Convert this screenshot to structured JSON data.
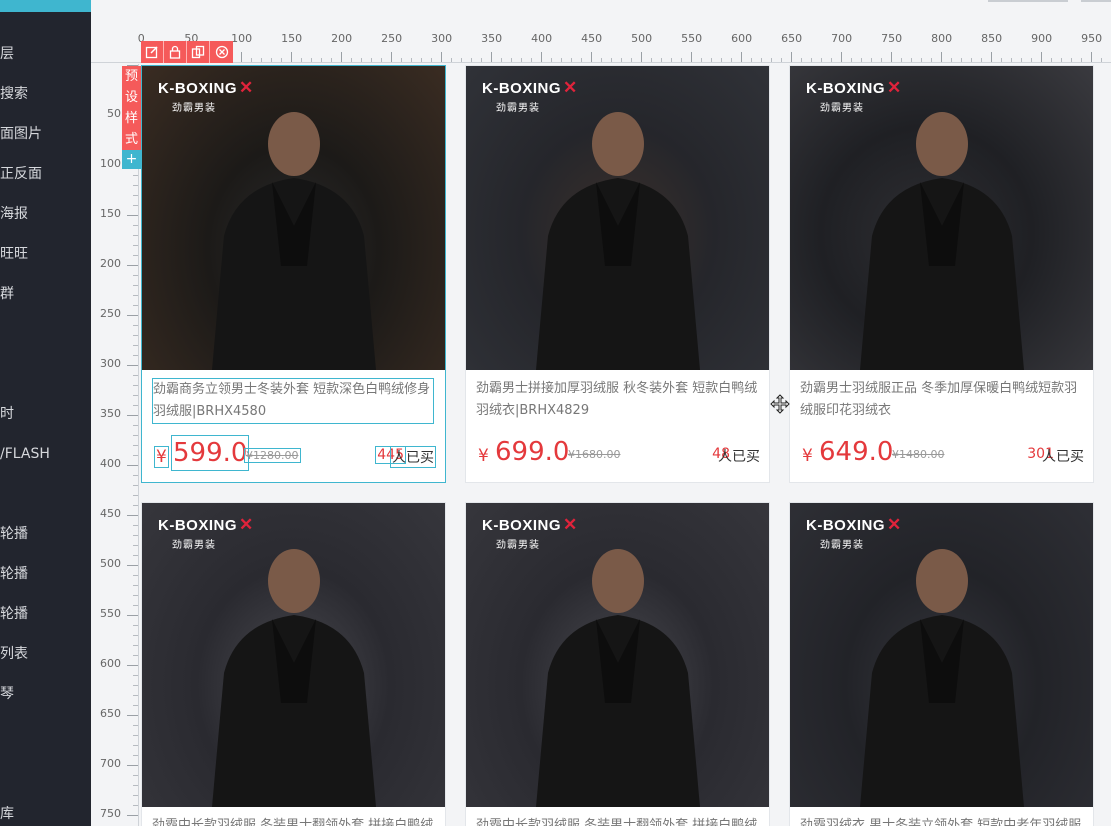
{
  "sidebar": {
    "items": [
      "层",
      "搜索",
      "面图片",
      "正反面",
      "海报",
      "旺旺",
      "群",
      "时",
      "/FLASH",
      "轮播",
      "轮播",
      "轮播",
      "列表",
      "琴",
      "库"
    ]
  },
  "ruler": {
    "top_labels": [
      "0",
      "50",
      "100",
      "150",
      "200",
      "250",
      "300",
      "350",
      "400",
      "450",
      "500",
      "550",
      "600",
      "650",
      "700",
      "750",
      "800",
      "850",
      "900",
      "950"
    ],
    "left_labels": [
      "50",
      "100",
      "150",
      "200",
      "250",
      "300",
      "350",
      "400",
      "450",
      "500",
      "550",
      "600",
      "650",
      "700",
      "750"
    ]
  },
  "toolbar": {
    "icons": [
      "edit-icon",
      "lock-icon",
      "copy-icon",
      "delete-icon"
    ]
  },
  "preset": {
    "label_chars": [
      "预",
      "设",
      "样",
      "式"
    ],
    "add_label": "+"
  },
  "products": [
    {
      "brand": "K-BOXING",
      "brand_sub": "劲霸男装",
      "title": "劲霸商务立领男士冬装外套 短款深色白鸭绒修身羽绒服|BRHX4580",
      "currency": "¥",
      "price": "599.0",
      "old_price": "¥1280.00",
      "sold_count": "445",
      "sold_label": "人已买",
      "selected": true
    },
    {
      "brand": "K-BOXING",
      "brand_sub": "劲霸男装",
      "title": "劲霸男士拼接加厚羽绒服 秋冬装外套 短款白鸭绒羽绒衣|BRHX4829",
      "currency": "¥",
      "price": "699.0",
      "old_price": "¥1680.00",
      "sold_count": "48",
      "sold_label": "人已买",
      "selected": false
    },
    {
      "brand": "K-BOXING",
      "brand_sub": "劲霸男装",
      "title": "劲霸男士羽绒服正品 冬季加厚保暖白鸭绒短款羽绒服印花羽绒衣",
      "currency": "¥",
      "price": "649.0",
      "old_price": "¥1480.00",
      "sold_count": "301",
      "sold_label": "人已买",
      "selected": false
    },
    {
      "brand": "K-BOXING",
      "brand_sub": "劲霸男装",
      "title": "劲霸中长款羽绒服 冬装男士翻领外套 拼接白鸭绒羽",
      "selected": false
    },
    {
      "brand": "K-BOXING",
      "brand_sub": "劲霸男装",
      "title": "劲霸中长款羽绒服 冬装男士翻领外套 拼接白鸭绒羽",
      "selected": false
    },
    {
      "brand": "K-BOXING",
      "brand_sub": "劲霸男装",
      "title": "劲霸羽绒衣 男士冬装立领外套 短款中老年羽绒服",
      "selected": false
    }
  ],
  "colors": {
    "accent": "#3fb6cf",
    "danger": "#f55a5a",
    "price": "#e4393c",
    "sidebar": "#22252e"
  }
}
